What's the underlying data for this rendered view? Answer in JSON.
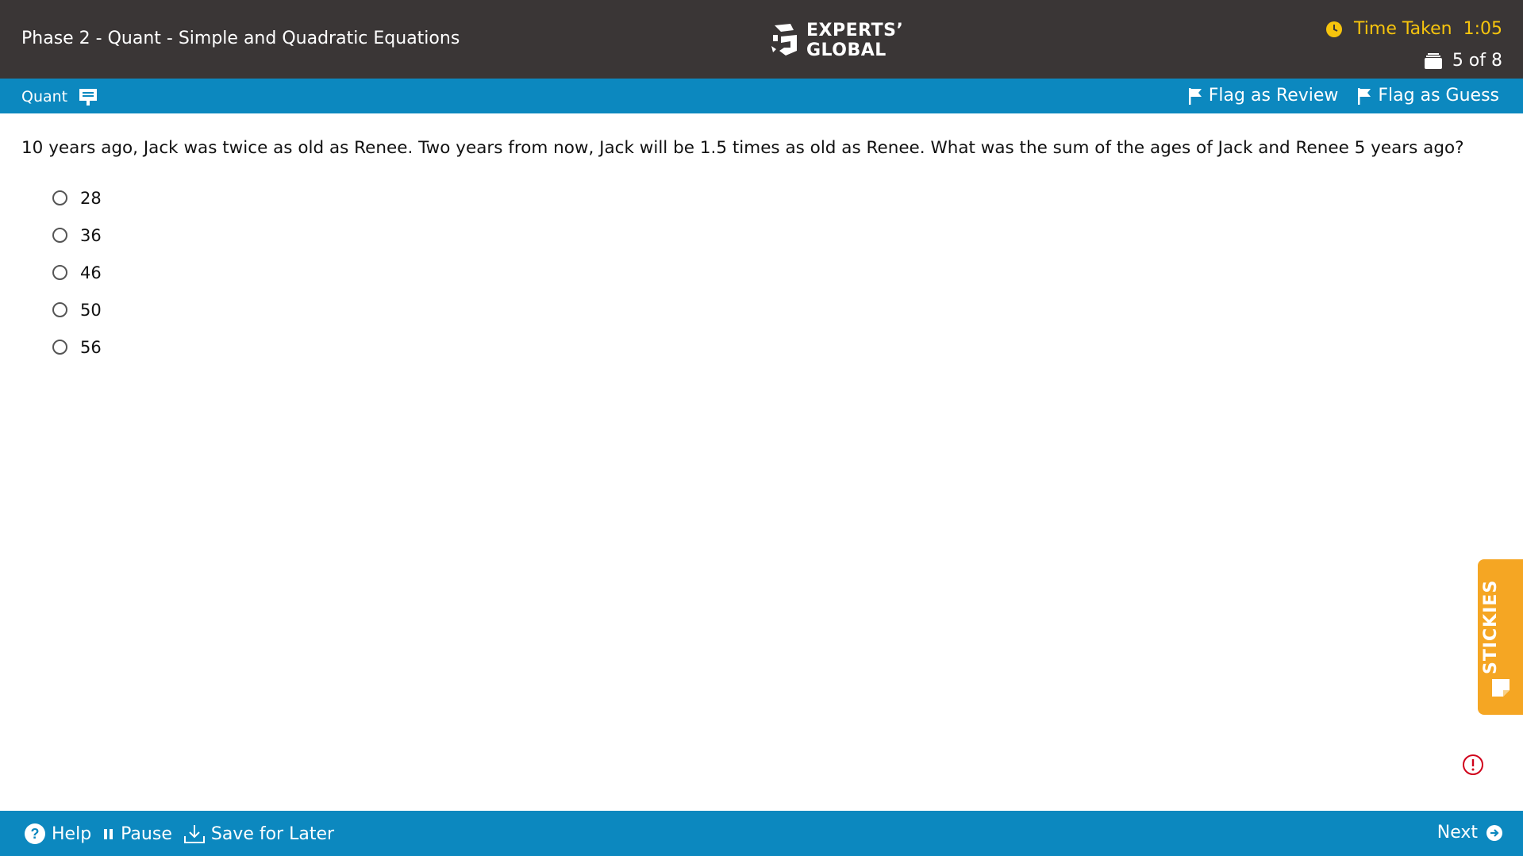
{
  "header": {
    "test_title": "Phase 2 - Quant - Simple and Quadratic Equations",
    "logo": {
      "line1": "EXPERTS’",
      "line2": "GLOBAL"
    },
    "timer_label": "Time Taken",
    "timer_value": "1:05",
    "progress": "5 of 8",
    "timer_color": "#f6c40d"
  },
  "subbar": {
    "section": "Quant",
    "flag_review": "Flag as Review",
    "flag_guess": "Flag as Guess",
    "color": "#0c88bf"
  },
  "question": {
    "text": "10 years ago, Jack was twice as old as Renee. Two years from now, Jack will be 1.5 times as old as Renee. What was the sum of the ages of Jack and Renee 5 years ago?",
    "options": [
      "28",
      "36",
      "46",
      "50",
      "56"
    ]
  },
  "stickies": {
    "label": "STICKIES",
    "color": "#f5a623"
  },
  "footer": {
    "help": "Help",
    "pause": "Pause",
    "save": "Save for Later",
    "next": "Next"
  },
  "icons": [
    "clock-icon",
    "stack-icon",
    "calculator-icon",
    "flag-icon",
    "sticky-note-icon",
    "alert-icon",
    "help-icon",
    "pause-icon",
    "download-icon",
    "arrow-right-icon"
  ]
}
